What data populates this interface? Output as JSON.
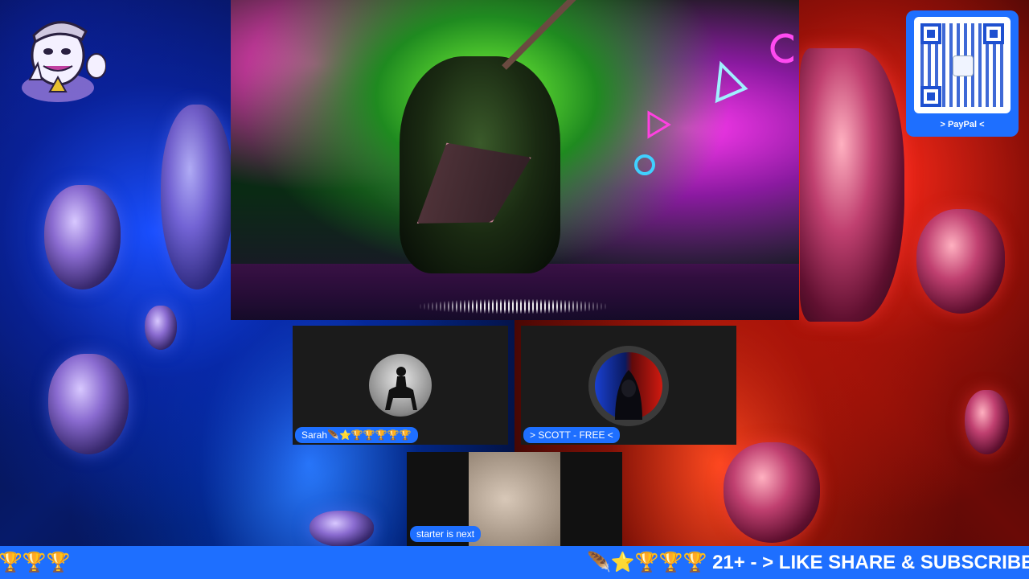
{
  "qr": {
    "label": "> PayPal <"
  },
  "participants": [
    {
      "name": "Sarah🪶⭐🏆🏆🏆🏆🏆"
    },
    {
      "name": "> SCOTT - FREE <"
    },
    {
      "name": "starter is next"
    }
  ],
  "ticker": {
    "left_text": "🏆🏆🏆",
    "right_text": "🪶⭐🏆🏆🏆 21+ - > LIKE SHARE & SUBSCRIBE"
  },
  "colors": {
    "accent": "#1e6fff",
    "tile": "#1b1b1b"
  }
}
